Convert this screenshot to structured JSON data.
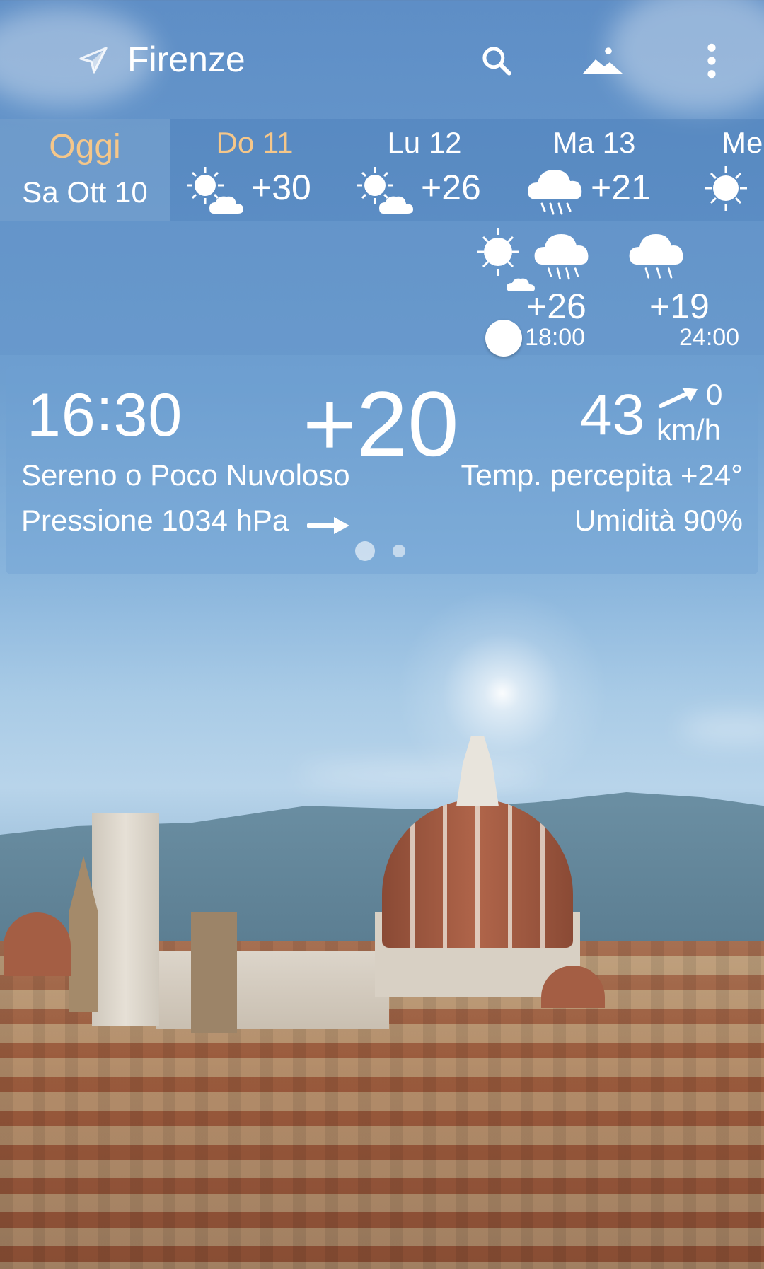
{
  "header": {
    "city": "Firenze",
    "icons": [
      "location-arrow-icon",
      "search-icon",
      "landscape-icon",
      "more-vert-icon"
    ]
  },
  "days": {
    "today": {
      "label": "Oggi",
      "date": "Sa Ott 10"
    },
    "items": [
      {
        "name": "Do 11",
        "temp": "+30",
        "icon": "sun-cloud-icon",
        "highlight": true
      },
      {
        "name": "Lu 12",
        "temp": "+26",
        "icon": "sun-cloud-icon",
        "highlight": false
      },
      {
        "name": "Ma 13",
        "temp": "+21",
        "icon": "rain-cloud-icon",
        "highlight": false
      },
      {
        "name": "Me",
        "temp": "",
        "icon": "sun-icon",
        "highlight": false
      }
    ]
  },
  "hourly": {
    "items": [
      {
        "temp": "+26",
        "time": "18:00",
        "icon": "sun-cloud-icon"
      },
      {
        "temp": "+19",
        "time": "24:00",
        "icon": "rain-cloud-icon"
      }
    ],
    "extra_icon": "rain-cloud-icon"
  },
  "current": {
    "time_h": "16",
    "time_m": "30",
    "temp": "+20",
    "wind_speed": "43",
    "wind_dir_value": "0",
    "wind_unit": "km/h",
    "condition": "Sereno o Poco Nuvoloso",
    "feels_like": "Temp. percepita +24°",
    "pressure": "Pressione 1034 hPa",
    "humidity": "Umidità 90%"
  },
  "colors": {
    "accent_day": "#f5c78a",
    "sky_top": "#5e8ec6"
  },
  "page_indicator": {
    "count": 2,
    "active": 0
  }
}
